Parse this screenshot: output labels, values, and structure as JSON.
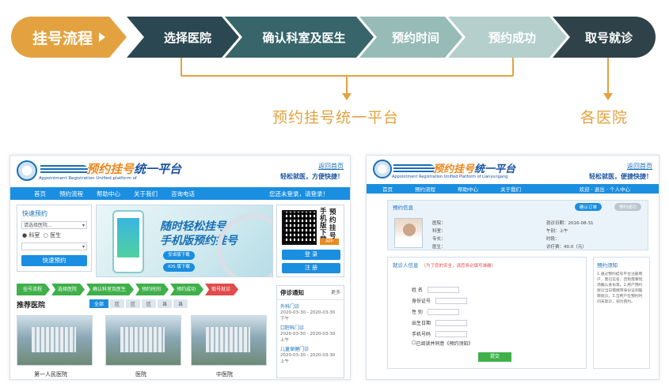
{
  "flow": {
    "steps": [
      "挂号流程",
      "选择医院",
      "确认科室及医生",
      "预约时间",
      "预约成功",
      "取号就诊"
    ],
    "captions": [
      "预约挂号统一平台",
      "各医院"
    ]
  },
  "colors": {
    "accent": "#e3a23f",
    "dark1": "#2b4852",
    "dark2": "#37656a",
    "light1": "#97bcb8",
    "light2": "#b4cfcc",
    "dark3": "#2f4249",
    "primary_blue": "#1a8ee0"
  },
  "portal": {
    "brand": "预约挂号",
    "brand_suffix": "统一平台",
    "brand_en": "Appointment Registration Unified platform of",
    "home_link": "返回首页",
    "slogan": "轻松就医，方便快捷！",
    "nav": [
      "首页",
      "预约流程",
      "帮助中心",
      "关于我们",
      "咨询电话"
    ],
    "login_hint": "您还未登录，请登录！",
    "quick": {
      "title": "快速预约",
      "select_placeholder": "请选择医院...",
      "radio_dept": "科室",
      "radio_doctor": "医生",
      "button": "快速预约"
    },
    "banner": {
      "line1": "随时轻松挂号",
      "line2": "手机版预约挂号",
      "android": "安卓版下载",
      "ios": "IOS 版下载"
    },
    "qr": {
      "text_a": "手机版下载",
      "text_b": "预约挂号",
      "app": "APP",
      "login": "登 录",
      "register": "注 册"
    },
    "mini_flow": [
      "挂号流程",
      "选择医院",
      "确认科室及医生",
      "预约时间",
      "预约成功",
      "取号就诊"
    ],
    "recommend": {
      "title": "推荐医院",
      "tabs": [
        "全部",
        "区",
        "区",
        "区",
        "县",
        "县"
      ],
      "hospitals": [
        "第一人民医院",
        "医院",
        "中医院"
      ]
    },
    "notice": {
      "title": "停诊通知",
      "more": "更多",
      "items": [
        {
          "name": "外科门诊",
          "date": "2020-03-30 - 2020-03-30 下午"
        },
        {
          "name": "口腔科门诊",
          "date": "2020-03-30 - 2020-03-30 上午"
        },
        {
          "name": "儿童保健门诊",
          "date": "2020-03-30 - 2020-03-30 上午"
        }
      ]
    }
  },
  "booking": {
    "brand": "预约挂号",
    "brand_suffix": "统一平台",
    "brand_en": "Appointment Registration Unified Platform of Lianyungang",
    "home_link": "返回首页",
    "slogan": "轻松就医，便捷快捷！",
    "nav": [
      "首页",
      "预约流程",
      "帮助中心",
      "关于我们"
    ],
    "nav_right": "欢迎 · 退出 · 个人中心",
    "info": {
      "label": "预约信息",
      "step1": "确认订单",
      "step2": "预约成功",
      "lines": [
        "医院：",
        "科室：",
        "专长：",
        "医生：",
        "就诊日期：2016-08-31",
        "午别：上午",
        "时段：",
        "诊疗费：40.0（元）"
      ]
    },
    "form": {
      "label": "就诊人信息",
      "hint": "（为了您的安全，请您务必填写准确）",
      "fields": [
        "姓 名",
        "身份证号",
        "性 别",
        "出生日期",
        "手机号码"
      ],
      "agree": "已阅读并同意《预约须知》",
      "submit": "提交"
    },
    "notes": {
      "label": "预约须知",
      "text": "1.通过预约挂号平台注册用户，需已实名，否则需要现场确认身份等。2.用户预约就诊当日需携带身份证到医院就诊。3.当用户在预约时间未就诊，视为爽约。"
    }
  }
}
